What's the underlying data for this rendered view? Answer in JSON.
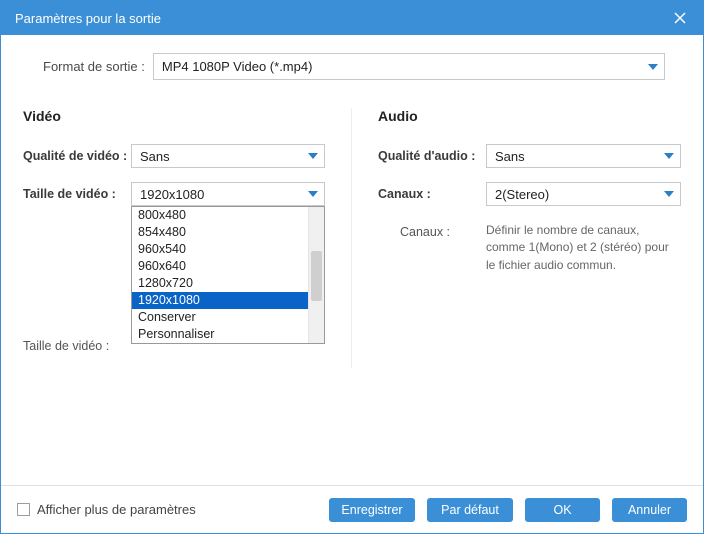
{
  "window": {
    "title": "Paramètres pour la sortie"
  },
  "format": {
    "label": "Format de sortie :",
    "value": "MP4 1080P Video (*.mp4)"
  },
  "video": {
    "header": "Vidéo",
    "quality_label": "Qualité de vidéo :",
    "quality_value": "Sans",
    "size_label": "Taille de vidéo :",
    "size_value": "1920x1080",
    "size_desc_label": "Taille de vidéo :",
    "size_options": [
      "800x480",
      "854x480",
      "960x540",
      "960x640",
      "1280x720",
      "1920x1080",
      "Conserver",
      "Personnaliser"
    ],
    "size_selected": "1920x1080"
  },
  "audio": {
    "header": "Audio",
    "quality_label": "Qualité d'audio :",
    "quality_value": "Sans",
    "channels_label": "Canaux :",
    "channels_value": "2(Stereo)",
    "channels_desc_label": "Canaux :",
    "channels_desc": "Définir le nombre de canaux, comme 1(Mono) et 2 (stéréo) pour le fichier audio commun."
  },
  "footer": {
    "more_params": "Afficher plus de paramètres",
    "save": "Enregistrer",
    "default": "Par défaut",
    "ok": "OK",
    "cancel": "Annuler"
  }
}
